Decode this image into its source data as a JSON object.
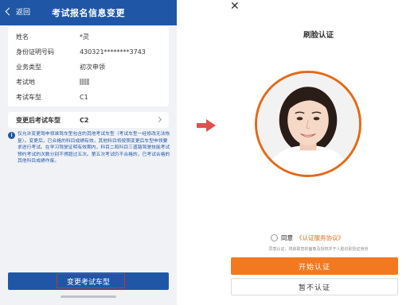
{
  "left": {
    "header": {
      "back_label": "返回",
      "title": "考试报名信息变更"
    },
    "info_rows": [
      {
        "label": "姓名",
        "value": "*灵"
      },
      {
        "label": "身份证明号码",
        "value": "430321********3743"
      },
      {
        "label": "业务类型",
        "value": "初次申领"
      },
      {
        "label": "考试地",
        "value": ""
      },
      {
        "label": "考试车型",
        "value": "C1"
      }
    ],
    "change_row": {
      "label": "变更后考试车型",
      "value": "C2"
    },
    "notice": "仅允许变更驾申领准驾车型包含的其他考试车型（考试车型一经修改无法恢复）。变更后，已合格的科目成绩有效，其他科目将按照变更后车型申领要求进行考试。在学习驾驶证明有效期内，科目二和科目三道路驾驶技能考试预约考试的次数分别不得超过五次。第五次考试仍不合格的，已考试合格的其他科目成绩作废。",
    "bottom_button": "变更考试车型"
  },
  "right": {
    "close_icon": "close-icon",
    "title": "刷脸认证",
    "agree_prefix": "同意",
    "agree_link": "《认证服务协议》",
    "consent": "同意认证，将获取您的面像及授权并于人脸识别授证身份",
    "start_button": "开始认证",
    "skip_button": "暂不认证"
  },
  "colors": {
    "header_blue": "#1f57a6",
    "accent_orange": "#f37920",
    "highlight_red": "#d62c2c",
    "arrow_red": "#d9534f"
  }
}
